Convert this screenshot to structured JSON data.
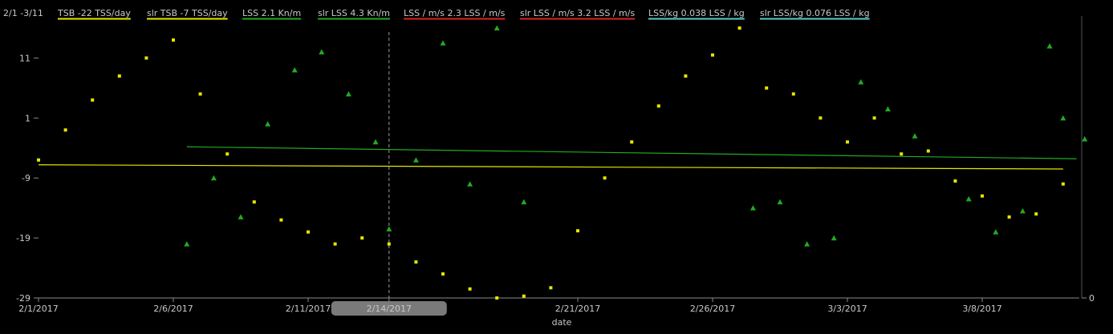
{
  "chart_data": {
    "type": "scatter",
    "date_range_label": "2/1 -3/11",
    "legend": [
      {
        "name": "TSB",
        "value": "-22 TSS/day",
        "color": "#e6e600"
      },
      {
        "name": "slr TSB",
        "value": "-7 TSS/day",
        "color": "#e6e600"
      },
      {
        "name": "LSS",
        "value": "2.1 Kn/m",
        "color": "#22aa22"
      },
      {
        "name": "slr LSS",
        "value": "4.3 Kn/m",
        "color": "#22aa22"
      },
      {
        "name": "LSS / m/s",
        "value": "2.3 LSS / m/s",
        "color": "#dd2222"
      },
      {
        "name": "slr LSS / m/s",
        "value": "3.2 LSS / m/s",
        "color": "#dd2222"
      },
      {
        "name": "LSS/kg",
        "value": "0.038 LSS / kg",
        "color": "#55cccc"
      },
      {
        "name": "slr LSS/kg",
        "value": "0.076 LSS / kg",
        "color": "#55cccc"
      }
    ],
    "xlabel": "date",
    "x_ticks": [
      {
        "day": 0,
        "label": "2/1/2017"
      },
      {
        "day": 5,
        "label": "2/6/2017"
      },
      {
        "day": 10,
        "label": "2/11/2017"
      },
      {
        "day": 13,
        "label": "2/14/2017",
        "highlight": true
      },
      {
        "day": 20,
        "label": "2/21/2017"
      },
      {
        "day": 25,
        "label": "2/26/2017"
      },
      {
        "day": 30,
        "label": "3/3/2017"
      },
      {
        "day": 35,
        "label": "3/8/2017"
      }
    ],
    "y_ticks": [
      11,
      1,
      -9,
      -19,
      -29
    ],
    "y_right_ticks": [
      0
    ],
    "ylim": [
      -29,
      18
    ],
    "xlim": [
      0,
      38.5
    ],
    "cursor_day": 13.0,
    "series": [
      {
        "name": "TSB",
        "marker": "square",
        "color": "#e6e600",
        "points": [
          [
            0.0,
            -6
          ],
          [
            1.0,
            -1
          ],
          [
            2.0,
            4
          ],
          [
            3.0,
            8
          ],
          [
            4.0,
            11
          ],
          [
            5.0,
            14
          ],
          [
            6.0,
            5
          ],
          [
            7.0,
            -5
          ],
          [
            8.0,
            -13
          ],
          [
            9.0,
            -16
          ],
          [
            10.0,
            -18
          ],
          [
            11.0,
            -20
          ],
          [
            12.0,
            -19
          ],
          [
            13.0,
            -20
          ],
          [
            14.0,
            -23
          ],
          [
            15.0,
            -25
          ],
          [
            16.0,
            -27.5
          ],
          [
            17.0,
            -29
          ],
          [
            18.0,
            -28.7
          ],
          [
            19.0,
            -27.3
          ],
          [
            20.0,
            -17.8
          ],
          [
            21.0,
            -9
          ],
          [
            22.0,
            -3
          ],
          [
            23.0,
            3
          ],
          [
            24.0,
            8
          ],
          [
            25.0,
            11.5
          ],
          [
            26.0,
            16
          ],
          [
            27.0,
            6
          ],
          [
            28.0,
            5
          ],
          [
            29.0,
            1
          ],
          [
            30.0,
            -3
          ],
          [
            31.0,
            1
          ],
          [
            32.0,
            -5
          ],
          [
            33.0,
            -4.5
          ],
          [
            34.0,
            -9.5
          ],
          [
            35.0,
            -12
          ],
          [
            36.0,
            -15.5
          ],
          [
            37.0,
            -15
          ],
          [
            38.0,
            -10
          ]
        ]
      },
      {
        "name": "LSS",
        "marker": "triangle",
        "color": "#22aa22",
        "points": [
          [
            5.5,
            -20
          ],
          [
            6.5,
            -9
          ],
          [
            7.5,
            -15.5
          ],
          [
            8.5,
            0
          ],
          [
            9.5,
            9
          ],
          [
            10.5,
            12
          ],
          [
            11.5,
            5
          ],
          [
            12.5,
            -3
          ],
          [
            13.0,
            -17.5
          ],
          [
            14.0,
            -6
          ],
          [
            15.0,
            13.5
          ],
          [
            16.0,
            -10
          ],
          [
            17.0,
            16
          ],
          [
            18.0,
            -13
          ],
          [
            26.5,
            -14
          ],
          [
            27.5,
            -13
          ],
          [
            28.5,
            -20
          ],
          [
            29.5,
            -19
          ],
          [
            30.5,
            7
          ],
          [
            31.5,
            2.5
          ],
          [
            32.5,
            -2
          ],
          [
            34.5,
            -12.5
          ],
          [
            35.5,
            -18
          ],
          [
            36.5,
            -14.5
          ],
          [
            37.5,
            13
          ],
          [
            38.0,
            1
          ],
          [
            38.8,
            -2.5
          ]
        ]
      }
    ],
    "lines": [
      {
        "name": "slr LSS",
        "color": "#22aa22",
        "from": [
          5.5,
          -3.8
        ],
        "to": [
          38.5,
          -5.8
        ]
      },
      {
        "name": "slr TSB",
        "color": "#e6e600",
        "from": [
          0.0,
          -6.8
        ],
        "to": [
          38.0,
          -7.5
        ]
      }
    ]
  }
}
